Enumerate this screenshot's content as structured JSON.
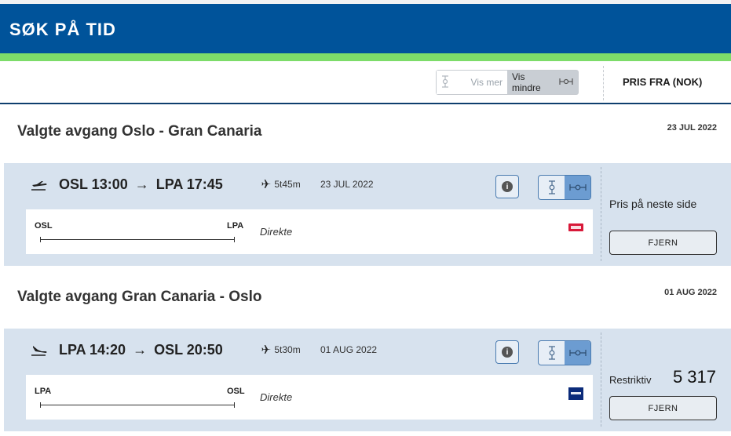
{
  "header": {
    "title": "SØK PÅ TID"
  },
  "toolbar": {
    "vis_mer": "Vis mer",
    "vis_mindre": "Vis mindre",
    "pris_fra": "PRIS FRA (NOK)"
  },
  "colors": {
    "brand_blue": "#00539a",
    "accent_green": "#7ddc69",
    "panel_bg": "#d7e2ee"
  },
  "outbound": {
    "title": "Valgte avgang Oslo - Gran Canaria",
    "date_header": "23 JUL 2022",
    "from_code": "OSL",
    "dep_time": "13:00",
    "to_code": "LPA",
    "arr_time": "17:45",
    "route_from": "OSL 13:00",
    "route_to": "LPA 17:45",
    "duration": "5t45m",
    "date": "23 JUL 2022",
    "stops": "Direkte",
    "airline_icon": "norwegian-logo",
    "price_text": "Pris på neste side",
    "remove_label": "FJERN"
  },
  "inbound": {
    "title": "Valgte avgang Gran Canaria - Oslo",
    "date_header": "01 AUG 2022",
    "from_code": "LPA",
    "dep_time": "14:20",
    "to_code": "OSL",
    "arr_time": "20:50",
    "route_from": "LPA 14:20",
    "route_to": "OSL 20:50",
    "duration": "5t30m",
    "date": "01 AUG 2022",
    "stops": "Direkte",
    "airline_icon": "sas-logo",
    "fare_type": "Restriktiv",
    "price": "5 317",
    "remove_label": "FJERN"
  },
  "icons": {
    "info": "info-icon",
    "expand": "expand-vertical-icon",
    "collapse": "collapse-horizontal-icon",
    "plane": "plane-icon",
    "takeoff": "takeoff-icon",
    "landing": "landing-icon",
    "arrow": "→",
    "info_glyph": "i"
  }
}
